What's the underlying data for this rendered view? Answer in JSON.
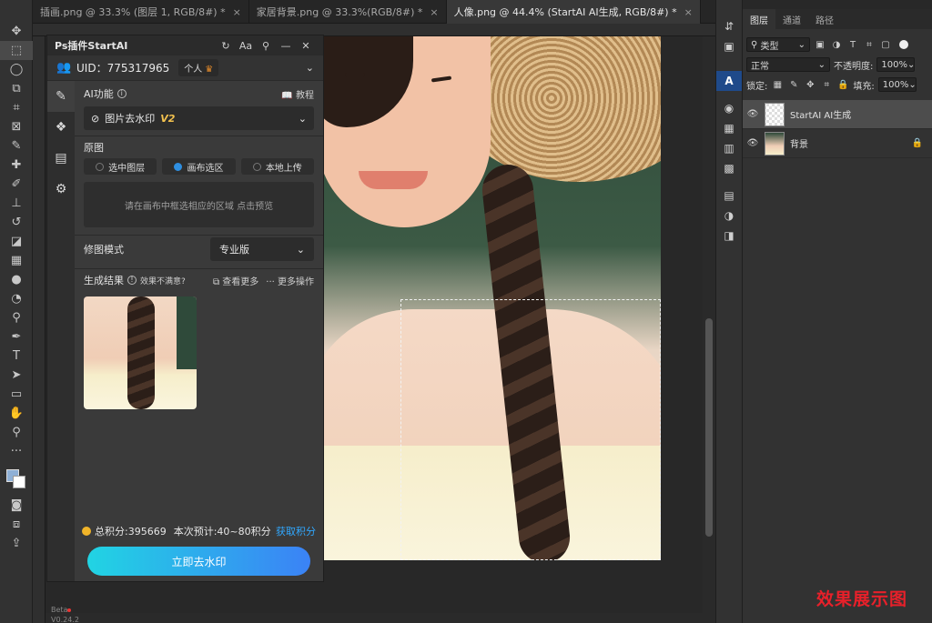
{
  "tabs": [
    {
      "label": "插画.png @ 33.3% (图层 1, RGB/8#) *",
      "close": "×",
      "active": false
    },
    {
      "label": "家居背景.png @ 33.3%(RGB/8#) *",
      "close": "×",
      "active": false
    },
    {
      "label": "人像.png @ 44.4% (StartAI AI生成, RGB/8#) *",
      "close": "×",
      "active": true
    }
  ],
  "plugin": {
    "title": "Ps插件StartAI",
    "header_icons": [
      "refresh-icon",
      "font-icon",
      "pin-icon",
      "minimize-icon",
      "close-icon"
    ],
    "header_glyphs": {
      "refresh": "↻",
      "font": "Aa",
      "pin": "⚲",
      "minimize": "—",
      "close": "✕"
    },
    "uid_label": "UID：775317965",
    "account_badge": "个人",
    "ai_feature_label": "AI功能",
    "tutorial_label": "教程",
    "feature_name": "图片去水印",
    "feature_version": "V2",
    "source_label": "原图",
    "source_options": [
      "选中图层",
      "画布选区",
      "本地上传"
    ],
    "source_selected": "画布选区",
    "preview_hint": "请在画布中框选相应的区域 点击预览",
    "mode_label": "修图模式",
    "mode_value": "专业版",
    "result_label": "生成结果",
    "result_feedback": "效果不满意?",
    "view_more": "查看更多",
    "more_actions": "更多操作",
    "points_total": "总积分:395669",
    "points_estimate": "本次预计:40~80积分",
    "get_points": "获取积分",
    "action_button": "立即去水印",
    "beta_label": "Beta",
    "version": "V0.24.2"
  },
  "layers_panel": {
    "tabs": [
      "图层",
      "通道",
      "路径"
    ],
    "filter_kind": "类型",
    "blend_mode": "正常",
    "opacity_label": "不透明度:",
    "opacity_value": "100%",
    "lock_label": "锁定:",
    "fill_label": "填充:",
    "fill_value": "100%",
    "layers": [
      {
        "name": "StartAI AI生成",
        "selected": true,
        "locked": false
      },
      {
        "name": "背景",
        "selected": false,
        "locked": true
      }
    ]
  },
  "caption": "效果展示图",
  "colors": {
    "accent": "#31a8ff",
    "button_start": "#21d4e3",
    "button_end": "#3b82f6",
    "caption": "#e8202a",
    "version_badge": "#f2c14e"
  }
}
